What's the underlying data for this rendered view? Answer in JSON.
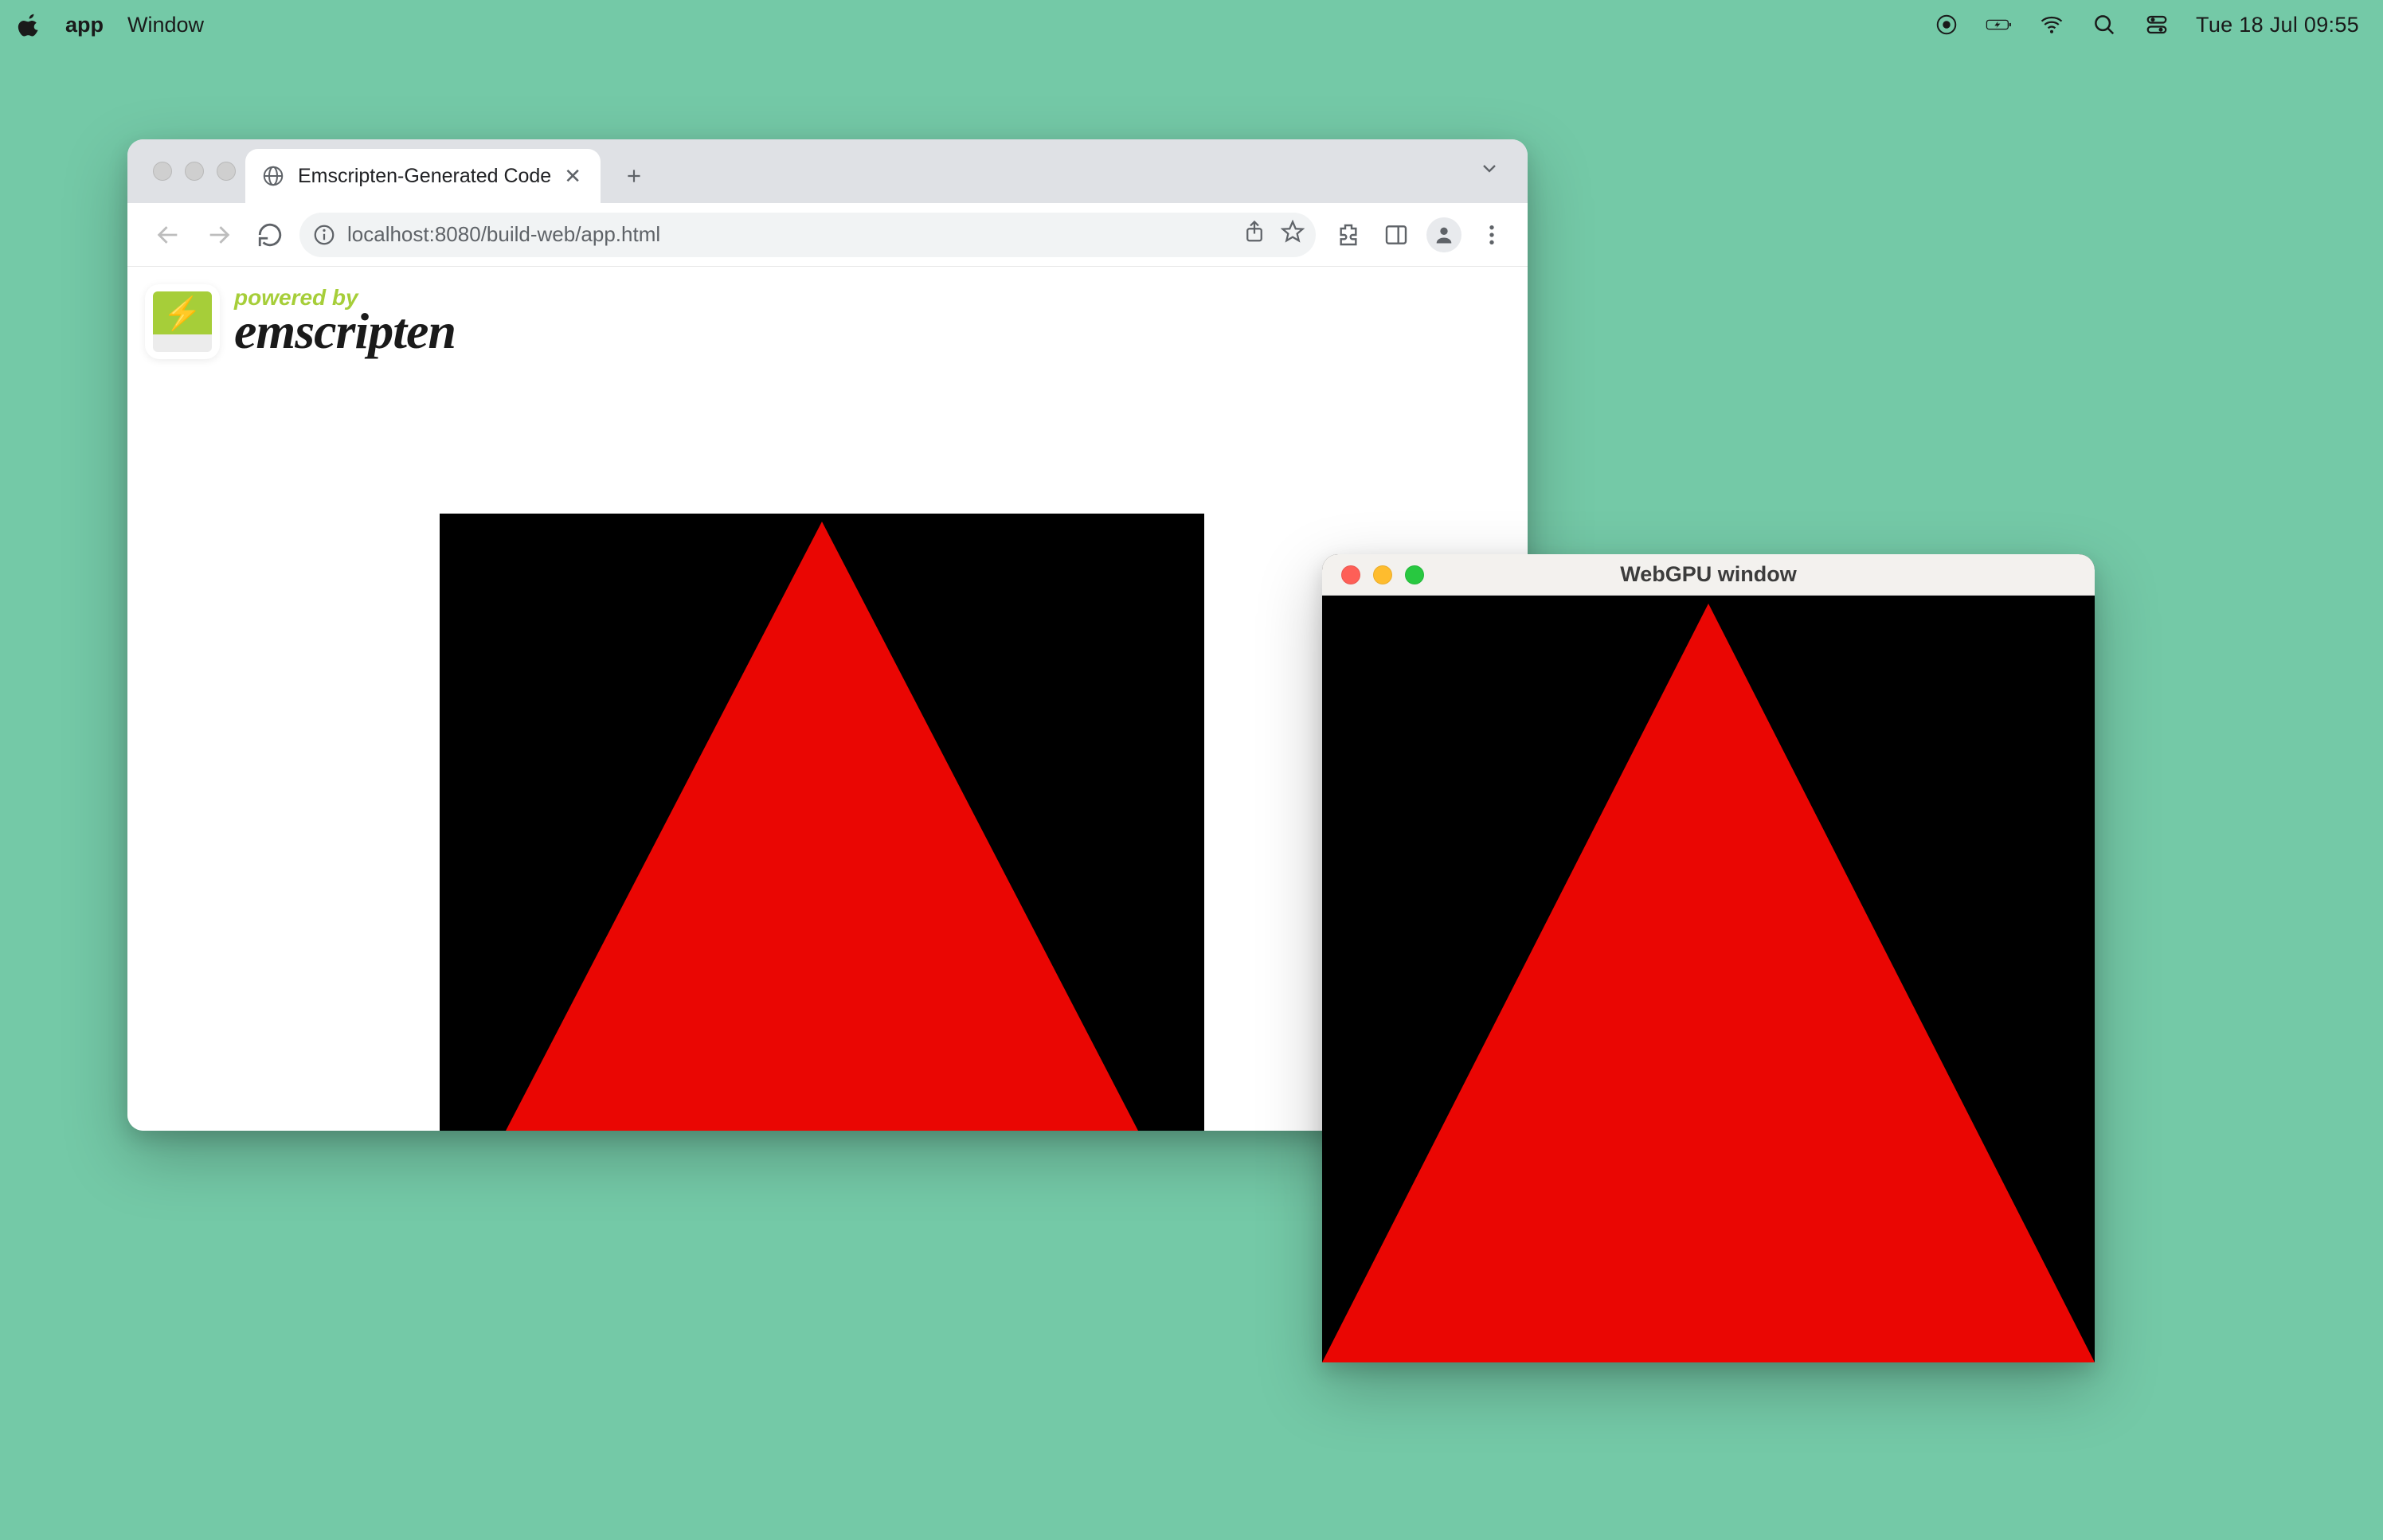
{
  "menubar": {
    "app_name": "app",
    "menu_window": "Window",
    "clock": "Tue 18 Jul  09:55"
  },
  "browser": {
    "tab_title": "Emscripten-Generated Code",
    "url_host": "localhost",
    "url_port_path": ":8080/build-web/app.html",
    "banner_powered": "powered by",
    "banner_brand": "emscripten"
  },
  "native": {
    "title": "WebGPU window"
  },
  "colors": {
    "desktop_bg": "#74c9a7",
    "canvas_bg": "#000000",
    "triangle": "#ea0603"
  }
}
